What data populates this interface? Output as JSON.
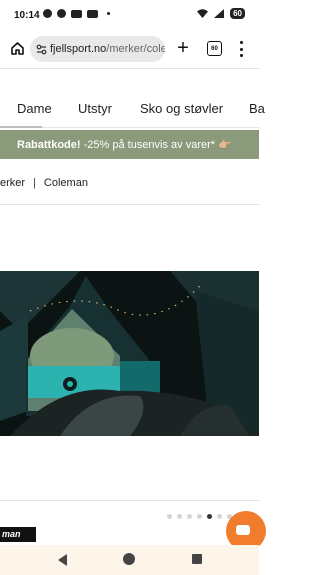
{
  "status_bar": {
    "time": "10:14",
    "notification_icons": [
      "facebook-icon",
      "snapchat-icon",
      "news-icon",
      "news-icon"
    ],
    "battery": "60"
  },
  "browser": {
    "url_domain": "fjellsport.no",
    "url_path": "/merker/cole"
  },
  "tab_count": "60",
  "nav": {
    "items": [
      "Dame",
      "Utstyr",
      "Sko og støvler",
      "Ba"
    ]
  },
  "promo": {
    "bold": "Rabattkode!",
    "text": " -25% på tusenvis av varer* 👉🏼"
  },
  "breadcrumb": {
    "parent": "erker",
    "separator": "|",
    "current": "Coleman"
  },
  "brand_logo_text": "man",
  "colors": {
    "promo_bg": "#8a9a7b",
    "chat_button": "#f07c2c"
  }
}
